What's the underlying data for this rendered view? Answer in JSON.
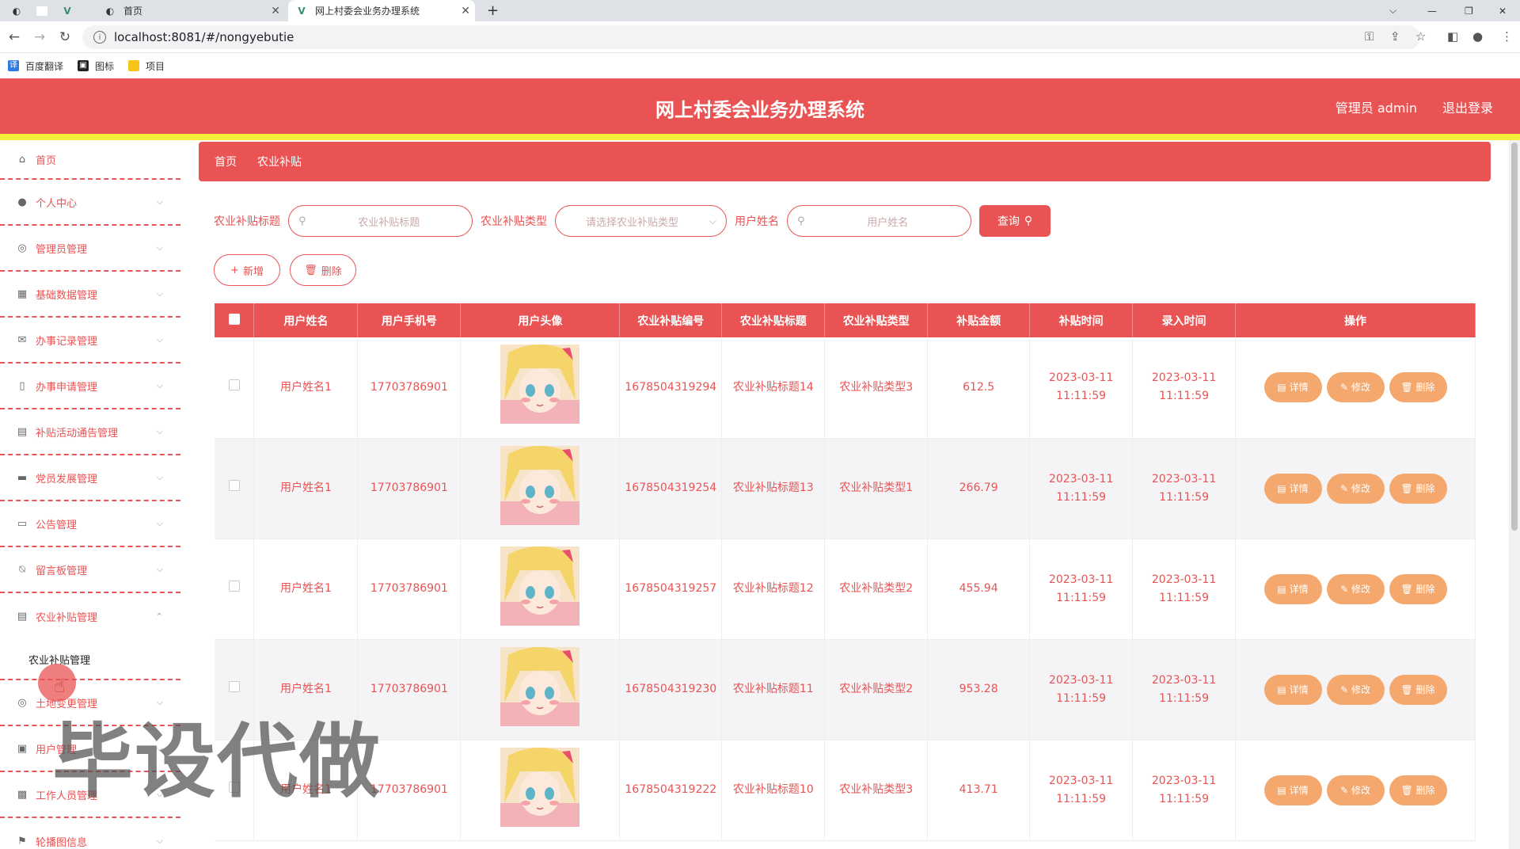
{
  "browser": {
    "tabs": [
      {
        "label": "首页"
      },
      {
        "label": "网上村委会业务办理系统"
      }
    ],
    "url": "localhost:8081/#/nongyebutie",
    "bookmarks": [
      {
        "label": "百度翻译"
      },
      {
        "label": "图标"
      },
      {
        "label": "项目"
      }
    ]
  },
  "header": {
    "title": "网上村委会业务办理系统",
    "admin": "管理员 admin",
    "logout": "退出登录"
  },
  "sidebar": {
    "items": [
      {
        "label": "首页",
        "icon": "home-icon"
      },
      {
        "label": "个人中心",
        "icon": "user-icon"
      },
      {
        "label": "管理员管理",
        "icon": "gauge-icon"
      },
      {
        "label": "基础数据管理",
        "icon": "grid-icon"
      },
      {
        "label": "办事记录管理",
        "icon": "mail-icon"
      },
      {
        "label": "办事申请管理",
        "icon": "phone-icon"
      },
      {
        "label": "补贴活动通告管理",
        "icon": "clipboard-icon"
      },
      {
        "label": "党员发展管理",
        "icon": "monitor-icon"
      },
      {
        "label": "公告管理",
        "icon": "chat-icon"
      },
      {
        "label": "留言板管理",
        "icon": "bell-off-icon"
      },
      {
        "label": "农业补贴管理",
        "icon": "clipboard-icon"
      }
    ],
    "subitem": "农业补贴管理",
    "items_after": [
      {
        "label": "土地变更管理",
        "icon": "target-icon"
      },
      {
        "label": "用户管理",
        "icon": "id-card-icon"
      },
      {
        "label": "工作人员管理",
        "icon": "film-icon"
      },
      {
        "label": "轮播图信息",
        "icon": "flag-icon"
      }
    ]
  },
  "watermark": "毕设代做",
  "breadcrumb": [
    "首页",
    "农业补贴"
  ],
  "search": {
    "title_label": "农业补贴标题",
    "title_placeholder": "农业补贴标题",
    "type_label": "农业补贴类型",
    "type_placeholder": "请选择农业补贴类型",
    "name_label": "用户姓名",
    "name_placeholder": "用户姓名",
    "query_button": "查询"
  },
  "actions": {
    "add": "新增",
    "delete": "删除"
  },
  "table": {
    "columns": [
      "用户姓名",
      "用户手机号",
      "用户头像",
      "农业补贴编号",
      "农业补贴标题",
      "农业补贴类型",
      "补贴金额",
      "补贴时间",
      "录入时间",
      "操作"
    ],
    "row_buttons": {
      "detail": "详情",
      "edit": "修改",
      "delete": "删除"
    },
    "rows": [
      {
        "name": "用户姓名1",
        "phone": "17703786901",
        "code": "1678504319294",
        "title": "农业补贴标题14",
        "type": "农业补贴类型3",
        "amount": "612.5",
        "subsidy_time": "2023-03-11 11:11:59",
        "entry_time": "2023-03-11 11:11:59"
      },
      {
        "name": "用户姓名1",
        "phone": "17703786901",
        "code": "1678504319254",
        "title": "农业补贴标题13",
        "type": "农业补贴类型1",
        "amount": "266.79",
        "subsidy_time": "2023-03-11 11:11:59",
        "entry_time": "2023-03-11 11:11:59"
      },
      {
        "name": "用户姓名1",
        "phone": "17703786901",
        "code": "1678504319257",
        "title": "农业补贴标题12",
        "type": "农业补贴类型2",
        "amount": "455.94",
        "subsidy_time": "2023-03-11 11:11:59",
        "entry_time": "2023-03-11 11:11:59"
      },
      {
        "name": "用户姓名1",
        "phone": "17703786901",
        "code": "1678504319230",
        "title": "农业补贴标题11",
        "type": "农业补贴类型2",
        "amount": "953.28",
        "subsidy_time": "2023-03-11 11:11:59",
        "entry_time": "2023-03-11 11:11:59"
      },
      {
        "name": "用户姓名1",
        "phone": "17703786901",
        "code": "1678504319222",
        "title": "农业补贴标题10",
        "type": "农业补贴类型3",
        "amount": "413.71",
        "subsidy_time": "2023-03-11 11:11:59",
        "entry_time": "2023-03-11 11:11:59"
      }
    ]
  },
  "colors": {
    "primary": "#e95353",
    "accent_strip": "#f5ec3c",
    "op_button": "#f4a86e"
  }
}
